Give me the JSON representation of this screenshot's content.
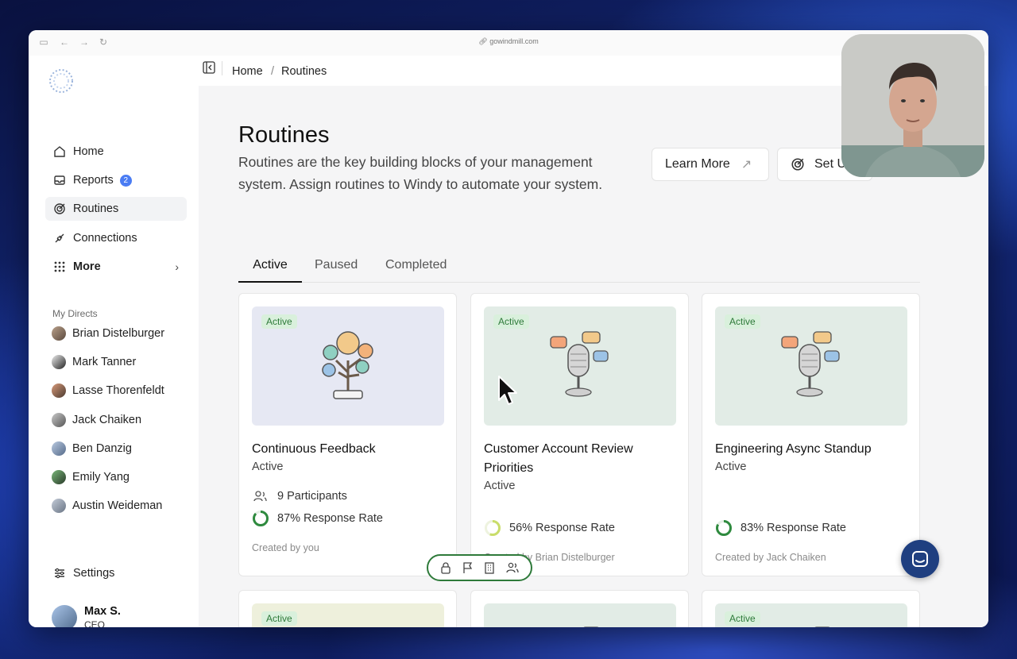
{
  "browser": {
    "url": "gowindmill.com"
  },
  "sidebar": {
    "nav": [
      {
        "label": "Home",
        "icon": "home-icon"
      },
      {
        "label": "Reports",
        "icon": "inbox-icon",
        "badge": "2"
      },
      {
        "label": "Routines",
        "icon": "target-icon"
      },
      {
        "label": "Connections",
        "icon": "plug-icon"
      },
      {
        "label": "More",
        "icon": "grid-icon"
      }
    ],
    "directs_label": "My Directs",
    "directs": [
      "Brian Distelburger",
      "Mark Tanner",
      "Lasse Thorenfeldt",
      "Jack Chaiken",
      "Ben Danzig",
      "Emily Yang",
      "Austin Weideman"
    ],
    "settings_label": "Settings",
    "profile": {
      "name": "Max S.",
      "role": "CEO"
    }
  },
  "breadcrumb": {
    "home": "Home",
    "separator": "/",
    "current": "Routines"
  },
  "page": {
    "title": "Routines",
    "description": "Routines are the key building blocks of your management system. Assign routines to Windy to automate your system.",
    "learn_more": "Learn More",
    "setup": "Set U"
  },
  "tabs": [
    "Active",
    "Paused",
    "Completed"
  ],
  "cards": [
    {
      "badge": "Active",
      "title": "Continuous Feedback",
      "status": "Active",
      "participants": "9 Participants",
      "response": "87% Response Rate",
      "response_value": 0.87,
      "creator": "Created by you"
    },
    {
      "badge": "Active",
      "title": "Customer Account Review Priorities",
      "status": "Active",
      "response": "56% Response Rate",
      "response_value": 0.56,
      "creator": "Created by Brian Distelburger"
    },
    {
      "badge": "Active",
      "title": "Engineering Async Standup",
      "status": "Active",
      "response": "83% Response Rate",
      "response_value": 0.83,
      "creator": "Created by Jack Chaiken"
    }
  ],
  "cards_row2": [
    {
      "badge": "Active"
    },
    {
      "badge": ""
    },
    {
      "badge": "Active"
    }
  ],
  "colors": {
    "accent": "#4a7cf3",
    "active_badge_bg": "#d9f0dc",
    "active_badge_text": "#2e7a3a",
    "ring_green": "#2e8a3e",
    "ring_yellow": "#c9dd6a"
  }
}
